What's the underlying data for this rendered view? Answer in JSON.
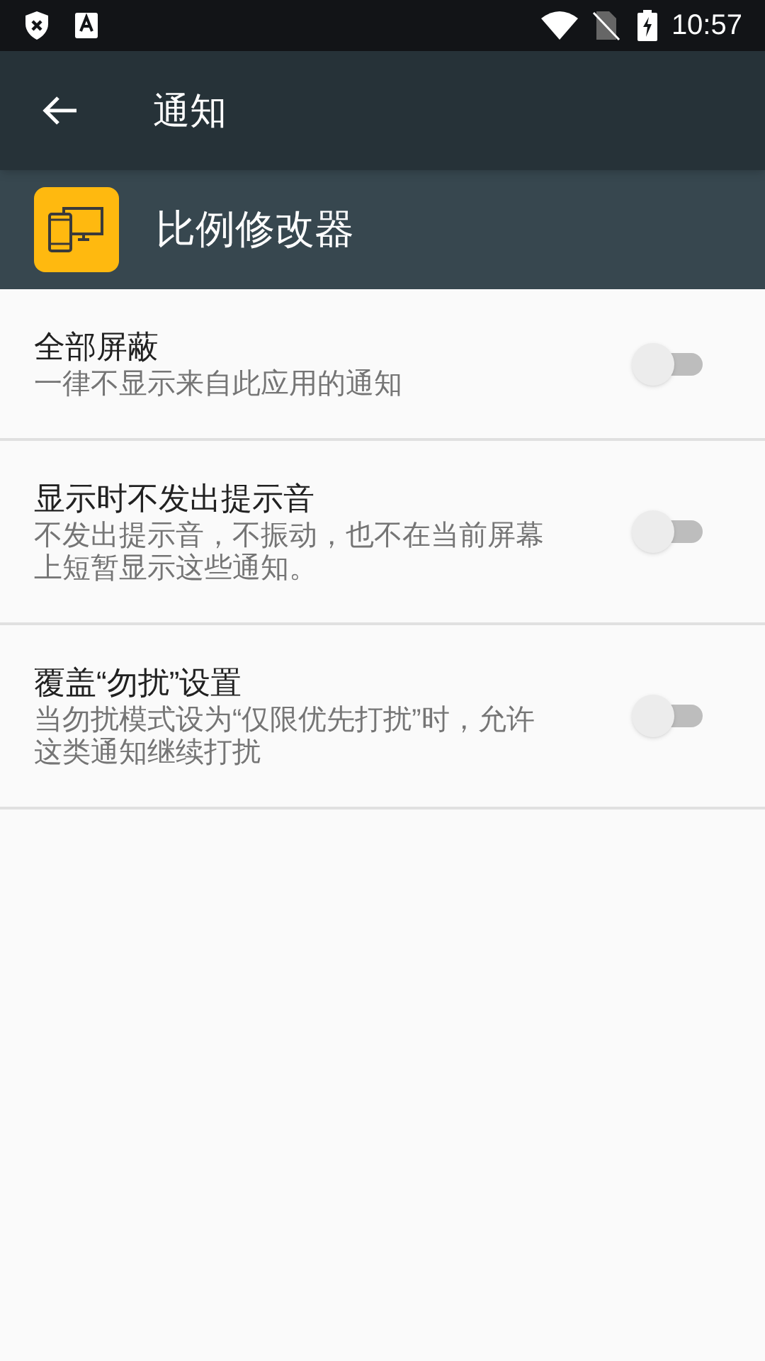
{
  "status_bar": {
    "time": "10:57"
  },
  "toolbar": {
    "title": "通知"
  },
  "app_header": {
    "name": "比例修改器"
  },
  "settings": [
    {
      "title": "全部屏蔽",
      "summary": "一律不显示来自此应用的通知",
      "on": false
    },
    {
      "title": "显示时不发出提示音",
      "summary": "不发出提示音，不振动，也不在当前屏幕上短暂显示这些通知。",
      "on": false
    },
    {
      "title": "覆盖“勿扰”设置",
      "summary": "当勿扰模式设为“仅限优先打扰”时，允许这类通知继续打扰",
      "on": false
    }
  ]
}
